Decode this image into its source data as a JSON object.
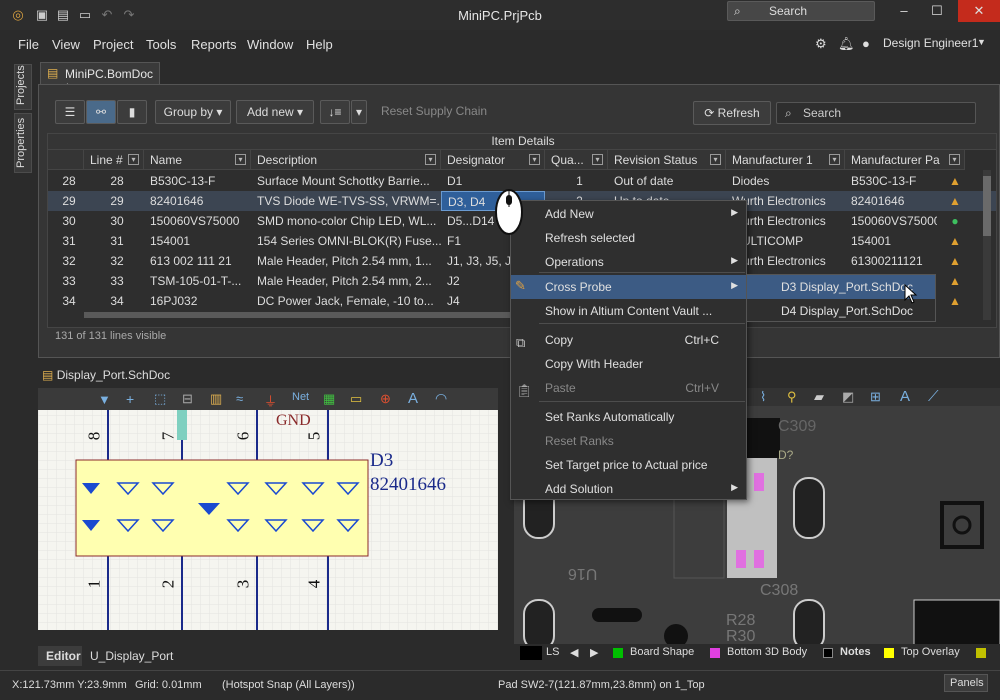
{
  "window": {
    "title": "MiniPC.PrjPcb",
    "search_label": "Search"
  },
  "menubar": {
    "items": [
      "File",
      "View",
      "Project",
      "Tools",
      "Reports",
      "Window",
      "Help"
    ],
    "user": "Design Engineer1"
  },
  "left_tabs": [
    "Projects",
    "Properties"
  ],
  "doc_tab": "MiniPC.BomDoc *",
  "bom": {
    "toolbar": {
      "group_by": "Group by",
      "add_new": "Add new",
      "reset_supply": "Reset Supply Chain",
      "refresh": "Refresh",
      "search": "Search"
    },
    "group_header": "Item Details",
    "columns": [
      "Line #",
      "Name",
      "Description",
      "Designator",
      "Qua...",
      "Revision Status",
      "Manufacturer 1",
      "Manufacturer Pa"
    ],
    "rows": [
      {
        "idx": "28",
        "line": "28",
        "name": "B530C-13-F",
        "desc": "Surface Mount Schottky Barrie...",
        "des": "D1",
        "qty": "1",
        "rev": "Out of date",
        "mfr": "Diodes",
        "mpn": "B530C-13-F",
        "status": "warn"
      },
      {
        "idx": "29",
        "line": "29",
        "name": "82401646",
        "desc": "TVS Diode WE-TVS-SS, VRWM=...",
        "des": "D3, D4",
        "qty": "2",
        "rev": "Up to date",
        "mfr": "Wurth Electronics",
        "mpn": "82401646",
        "status": "warn"
      },
      {
        "idx": "30",
        "line": "30",
        "name": "150060VS75000",
        "desc": "SMD mono-color Chip LED, WL...",
        "des": "D5...D14",
        "qty": "",
        "rev": "",
        "mfr": "Wurth Electronics",
        "mpn": "150060VS75000",
        "status": "ok"
      },
      {
        "idx": "31",
        "line": "31",
        "name": "154001",
        "desc": "154 Series OMNI-BLOK(R) Fuse...",
        "des": "F1",
        "qty": "",
        "rev": "",
        "mfr": "MULTICOMP",
        "mpn": "154001",
        "status": "warn"
      },
      {
        "idx": "32",
        "line": "32",
        "name": "613 002 111 21",
        "desc": "Male Header, Pitch 2.54 mm, 1...",
        "des": "J1, J3, J5, J18",
        "qty": "",
        "rev": "",
        "mfr": "Wurth Electronics",
        "mpn": "61300211121",
        "status": "warn"
      },
      {
        "idx": "33",
        "line": "33",
        "name": "TSM-105-01-T-...",
        "desc": "Male Header, Pitch 2.54 mm, 2...",
        "des": "J2",
        "qty": "",
        "rev": "",
        "mfr": "",
        "mpn": "",
        "status": "warn"
      },
      {
        "idx": "34",
        "line": "34",
        "name": "16PJ032",
        "desc": "DC Power Jack, Female, -10 to...",
        "des": "J4",
        "qty": "",
        "rev": "",
        "mfr": "",
        "mpn": "",
        "status": "warn"
      }
    ],
    "lines_visible": "131 of 131 lines visible"
  },
  "context_menu": {
    "items": [
      {
        "label": "Add New",
        "arrow": true
      },
      {
        "label": "Refresh selected"
      },
      {
        "label": "Operations",
        "arrow": true
      },
      {
        "label": "Cross Probe",
        "arrow": true,
        "highlight": true
      },
      {
        "label": "Show in Altium Content Vault ..."
      },
      {
        "label": "Copy",
        "shortcut": "Ctrl+C"
      },
      {
        "label": "Copy With Header"
      },
      {
        "label": "Paste",
        "shortcut": "Ctrl+V",
        "disabled": true
      },
      {
        "label": "Set Ranks Automatically"
      },
      {
        "label": "Reset Ranks",
        "disabled": true
      },
      {
        "label": "Set Target price to Actual price"
      },
      {
        "label": "Add Solution",
        "arrow": true
      }
    ],
    "submenu": [
      "D3 Display_Port.SchDoc",
      "D4 Display_Port.SchDoc"
    ]
  },
  "schematic": {
    "title": "Display_Port.SchDoc",
    "designator": "D3",
    "part": "82401646",
    "net": "GND",
    "pin_top": [
      "8",
      "7",
      "6",
      "5"
    ],
    "pin_bottom": [
      "1",
      "2",
      "3",
      "4"
    ],
    "tabs": [
      "Editor",
      "U_Display_Port"
    ]
  },
  "pcb": {
    "labels": [
      "C309",
      "U16",
      "C308",
      "R28",
      "R30",
      "D?"
    ]
  },
  "layers": [
    {
      "name": "LS",
      "color": "#000000"
    },
    {
      "name": "Board Shape",
      "color": "#00c000"
    },
    {
      "name": "Bottom 3D Body",
      "color": "#e040e0"
    },
    {
      "name": "Notes",
      "color": "#000000"
    },
    {
      "name": "Top Overlay",
      "color": "#ffff00"
    }
  ],
  "statusbar": {
    "coords": "X:121.73mm Y:23.9mm",
    "grid": "Grid: 0.01mm",
    "snap": "(Hotspot Snap (All Layers))",
    "pad": "Pad SW2-7(121.87mm,23.8mm) on 1_Top",
    "panels": "Panels"
  }
}
